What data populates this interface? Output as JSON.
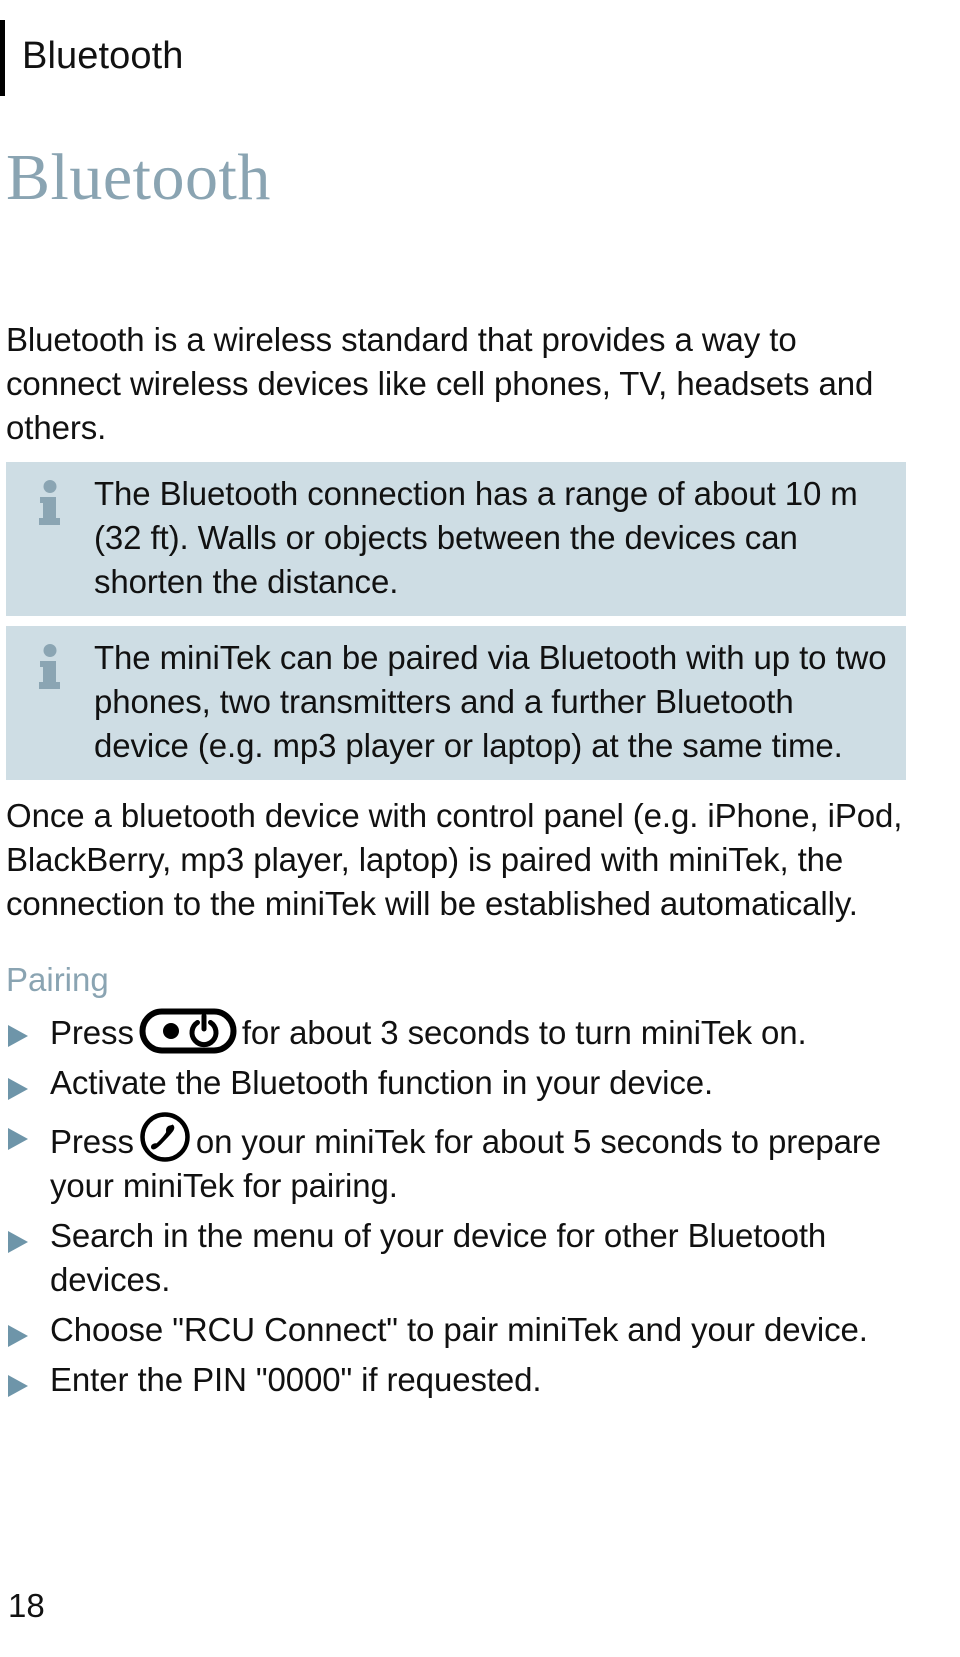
{
  "header": {
    "running_title": "Bluetooth"
  },
  "chapter": {
    "title": "Bluetooth"
  },
  "intro": {
    "paragraph": "Bluetooth is a wireless standard that provides a way to connect wireless devices like cell phones, TV, headsets and others."
  },
  "notes": [
    {
      "icon": "info-icon",
      "text": "The Bluetooth connection has a range of about 10 m (32 ft). Walls or objects between the devices can shorten the distance."
    },
    {
      "icon": "info-icon",
      "text": "The miniTek can be paired via Bluetooth with up to two phones, two transmitters and a further Bluetooth device (e.g. mp3 player or laptop) at the same time."
    }
  ],
  "body": {
    "paragraph": "Once a bluetooth device with control panel (e.g. iPhone, iPod, BlackBerry, mp3 player, laptop) is paired with miniTek, the connection to the miniTek will be established automatically."
  },
  "pairing": {
    "heading": "Pairing",
    "steps": [
      {
        "bullet": "triangle-bullet",
        "text_before": "Press",
        "icon": "power-button-icon",
        "text_after": "for about 3 seconds to turn miniTek on."
      },
      {
        "bullet": "triangle-bullet",
        "text_before": "Activate the Bluetooth function in your device.",
        "icon": "",
        "text_after": ""
      },
      {
        "bullet": "triangle-bullet",
        "text_before": "Press",
        "icon": "phone-handset-icon",
        "text_after": "on your miniTek for about 5 seconds to prepare your miniTek for pairing."
      },
      {
        "bullet": "triangle-bullet",
        "text_before": "Search in the menu of your device for other Bluetooth devices.",
        "icon": "",
        "text_after": ""
      },
      {
        "bullet": "triangle-bullet",
        "text_before": "Choose \"RCU Connect\" to pair miniTek and your device.",
        "icon": "",
        "text_after": ""
      },
      {
        "bullet": "triangle-bullet",
        "text_before": "Enter the PIN \"0000\" if requested.",
        "icon": "",
        "text_after": ""
      }
    ]
  },
  "footer": {
    "page_number": "18"
  },
  "colors": {
    "accent_blue_gray": "#8aa4b2",
    "note_background": "#cedde4",
    "note_icon": "#8ba5b3",
    "bullet": "#6e95a9",
    "text": "#111111",
    "header_rule": "#000000"
  }
}
